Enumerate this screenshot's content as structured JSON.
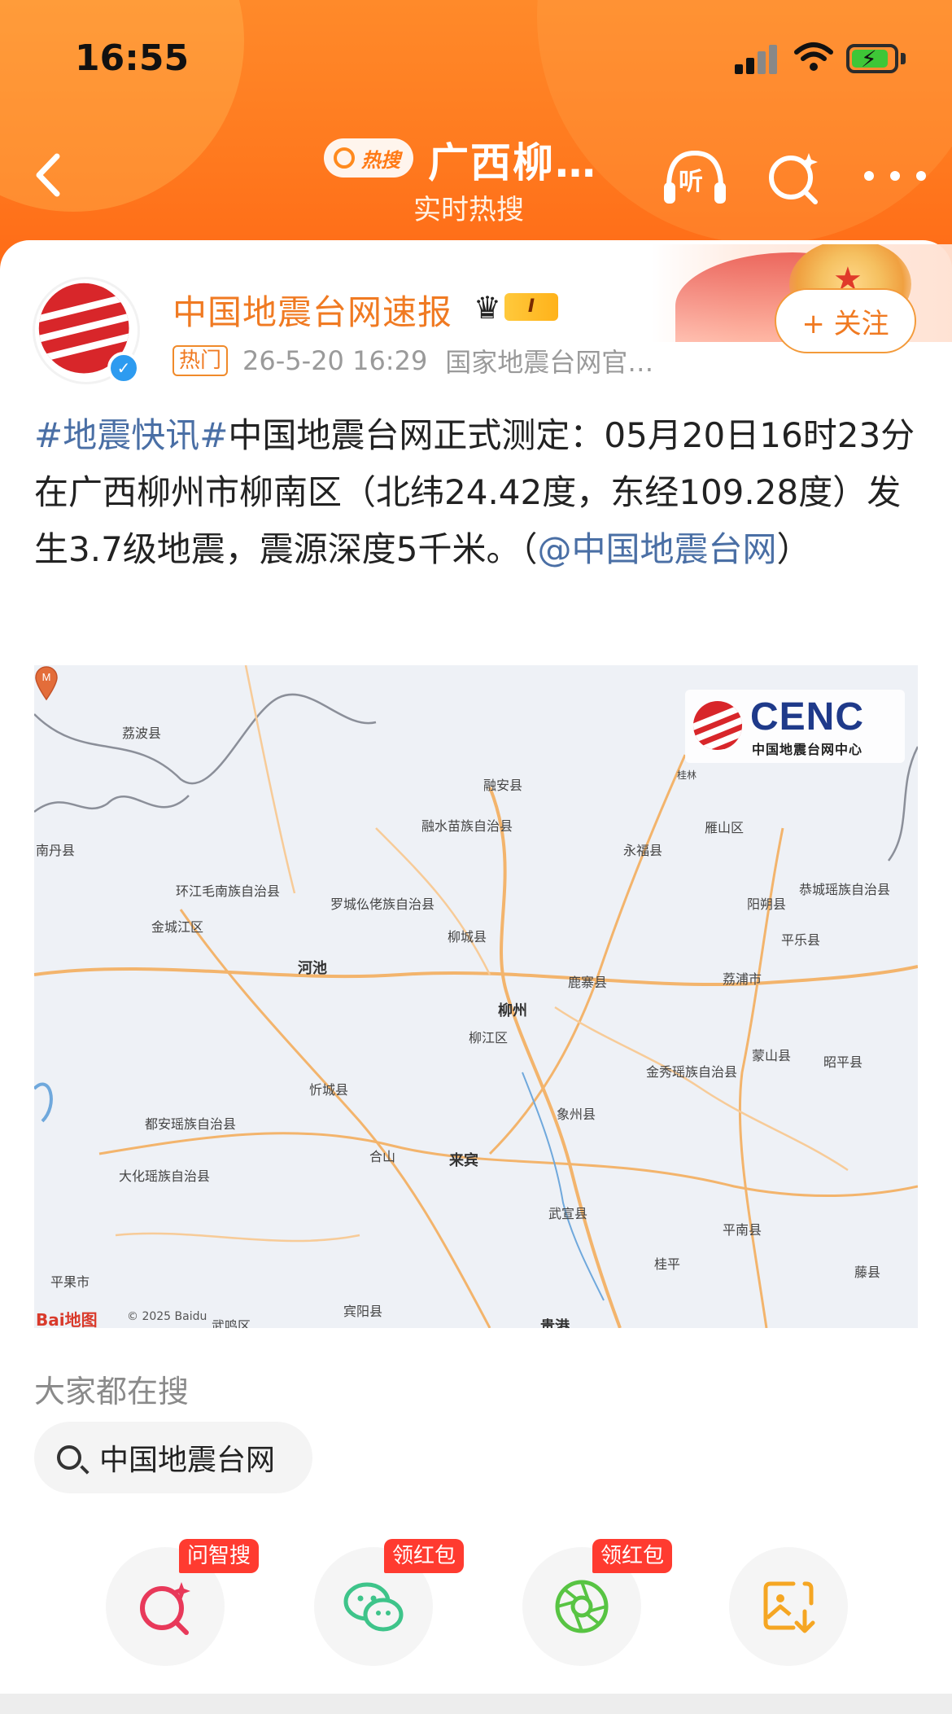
{
  "status_bar": {
    "time": "16:55"
  },
  "nav": {
    "hot_label": "热搜",
    "title": "广西柳…",
    "subtitle": "实时热搜",
    "listen_label": "听"
  },
  "post": {
    "author": "中国地震台网速报",
    "level_badge": "I",
    "tag": "热门",
    "time": "26-5-20 16:29",
    "source": "国家地震台网官…",
    "follow_label": "+ 关注",
    "topic": "#地震快讯#",
    "body": "中国地震台网正式测定：05月20日16时23分在广西柳州市柳南区（北纬24.42度，东经109.28度）发生3.7级地震，震源深度5千米。（",
    "mention": "@中国地震台网",
    "body_end": "）"
  },
  "map": {
    "logo_text": "CENC",
    "logo_sub": "中国地震台网中心",
    "marker_label": "M",
    "attribution_brand": "Bai地图",
    "attribution": "© 2025 Baidu",
    "places": {
      "lipo": "荔波县",
      "rongan": "融安县",
      "rongshui": "融水苗族自治县",
      "nandan": "南丹县",
      "yongfu": "永福县",
      "yanshan": "雁山区",
      "huanjiang": "环江毛南族自治县",
      "luocheng": "罗城仫佬族自治县",
      "gongcheng": "恭城瑶族自治县",
      "yangshuo": "阳朔县",
      "jinchengjiang": "金城江区",
      "liucheng": "柳城县",
      "pingle": "平乐县",
      "hechi": "河池",
      "luzhai": "鹿寨县",
      "lipu": "荔浦市",
      "liuzhou": "柳州",
      "liujiang": "柳江区",
      "mengshan": "蒙山县",
      "jinxiu": "金秀瑶族自治县",
      "zhaoping": "昭平县",
      "xincheng": "忻城县",
      "xiangzhou": "象州县",
      "duan": "都安瑶族自治县",
      "heshan": "合山",
      "laibin": "来宾",
      "dahua": "大化瑶族自治县",
      "wuxuan": "武宣县",
      "pingnan": "平南县",
      "guiping": "桂平",
      "tengxian": "藤县",
      "pingguo": "平果市",
      "binyang": "宾阳县",
      "wuming": "武鸣区",
      "guigang": "贵港",
      "guilin": "桂林"
    }
  },
  "search_section": {
    "heading": "大家都在搜",
    "chip": "中国地震台网"
  },
  "actions": [
    {
      "name": "ai-search",
      "badge": "问智搜",
      "color": "#e8395a"
    },
    {
      "name": "wechat",
      "badge": "领红包",
      "color": "#3ec48a"
    },
    {
      "name": "moments",
      "badge": "领红包",
      "color": "#58c443"
    },
    {
      "name": "save-image",
      "badge": "",
      "color": "#f5a623"
    }
  ]
}
